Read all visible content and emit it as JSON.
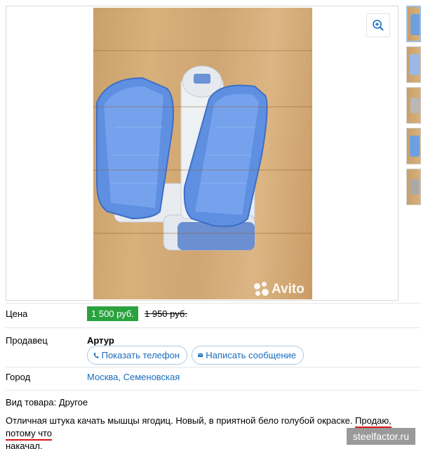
{
  "listing": {
    "photo_watermark": "Avito",
    "price_label": "Цена",
    "price": "1 500 руб.",
    "old_price": "1 950 руб.",
    "seller_label": "Продавец",
    "seller_name": "Артур",
    "show_phone": "Показать телефон",
    "write_message": "Написать сообщение",
    "city_label": "Город",
    "city_value": "Москва, Семеновская",
    "kind": "Вид товара: Другое",
    "description_1": "Отличная штука качать мышцы ягодиц. Новый, в приятной бело голубой окраске. ",
    "description_2": "Продаю, потому что",
    "description_3": "накачал."
  },
  "site_watermark": "steelfactor.ru",
  "colors": {
    "price_green": "#2aa23e",
    "link_blue": "#1a6dbf",
    "underline_red": "#d9151b"
  },
  "icons": [
    "zoom-in-icon",
    "phone-icon",
    "envelope-icon",
    "avito-logo-icon"
  ]
}
